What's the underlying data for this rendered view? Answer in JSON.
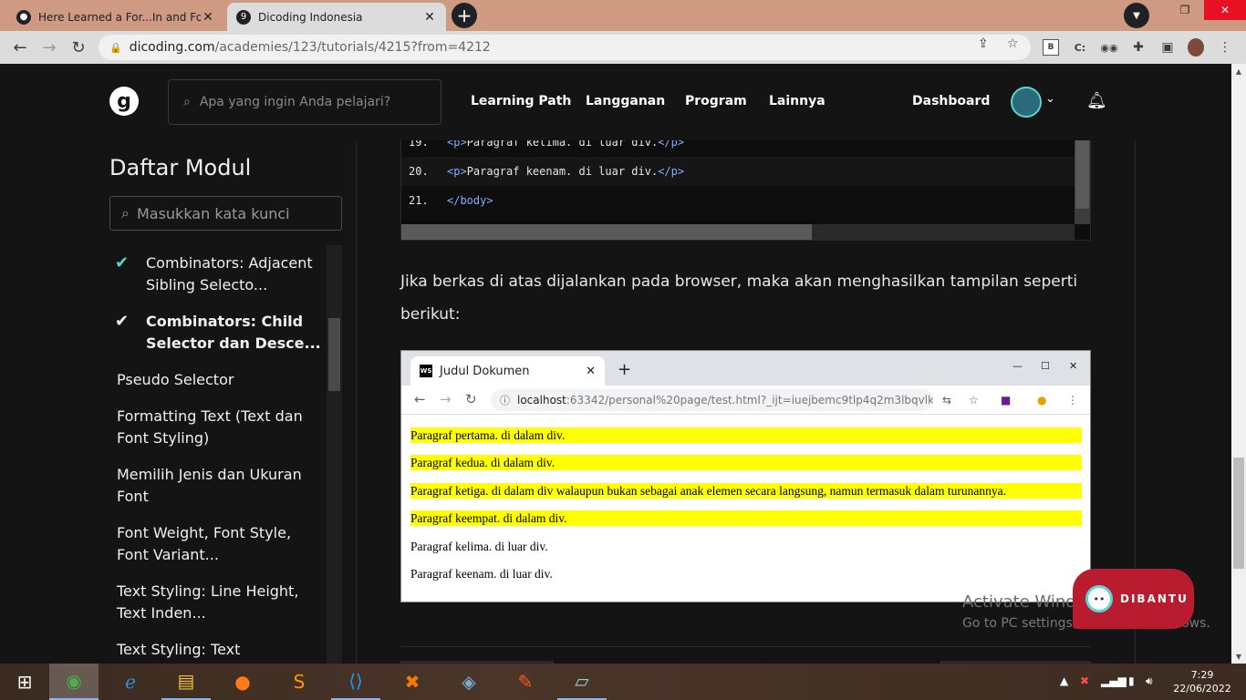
{
  "browser": {
    "tabs": [
      {
        "title": "Here Learned a For...In and For...O",
        "active": false
      },
      {
        "title": "Dicoding Indonesia",
        "active": true
      }
    ],
    "new_tab": "+",
    "url_host": "dicoding.com",
    "url_path": "/academies/123/tutorials/4215?from=4212"
  },
  "site": {
    "logo": "g",
    "search_placeholder": "Apa yang ingin Anda pelajari?",
    "nav": [
      "Learning Path",
      "Langganan",
      "Program",
      "Lainnya"
    ],
    "dashboard": "Dashboard"
  },
  "sidebar": {
    "title": "Daftar Modul",
    "search_placeholder": "Masukkan kata kunci",
    "items": [
      {
        "label": "Combinators: Adjacent Sibling Selecto...",
        "status": "done",
        "bold": false
      },
      {
        "label": "Combinators: Child Selector dan Desce...",
        "status": "current",
        "bold": true
      },
      {
        "label": "Pseudo Selector",
        "status": "none",
        "bold": false
      },
      {
        "label": "Formatting Text (Text dan Font Styling)",
        "status": "none",
        "bold": false
      },
      {
        "label": "Memilih Jenis dan Ukuran Font",
        "status": "none",
        "bold": false
      },
      {
        "label": "Font Weight, Font Style, Font Variant...",
        "status": "none",
        "bold": false
      },
      {
        "label": "Text Styling: Line Height, Text Inden...",
        "status": "none",
        "bold": false
      },
      {
        "label": "Text Styling: Text Decoration,",
        "status": "none",
        "bold": false
      }
    ]
  },
  "code": {
    "lines": [
      {
        "num": "19.",
        "open": "<p>",
        "text": "Paragraf kelima. di luar div.",
        "close": "</p>"
      },
      {
        "num": "20.",
        "open": "<p>",
        "text": "Paragraf keenam. di luar div.",
        "close": "</p>"
      },
      {
        "num": "21.",
        "open": "</body>",
        "text": "",
        "close": ""
      }
    ]
  },
  "content": {
    "paragraph": "Jika berkas di atas dijalankan pada browser, maka akan menghasilkan tampilan seperti berikut:"
  },
  "screenshot": {
    "tab_title": "Judul Dokumen",
    "url_host": "localhost",
    "url_rest": ":63342/personal%20page/test.html?_ijt=iuejbemc9tlp4q2m3lbqvlk...",
    "paragraphs": [
      {
        "text": "Paragraf pertama. di dalam div.",
        "highlight": true
      },
      {
        "text": "Paragraf kedua. di dalam div.",
        "highlight": true
      },
      {
        "text": "Paragraf ketiga. di dalam div walaupun bukan sebagai anak elemen secara langsung, namun termasuk dalam turunannya.",
        "highlight": true
      },
      {
        "text": "Paragraf keempat. di dalam div.",
        "highlight": true
      },
      {
        "text": "Paragraf kelima. di luar div.",
        "highlight": false
      },
      {
        "text": "Paragraf keenam. di luar div.",
        "highlight": false
      }
    ]
  },
  "overlay": {
    "activate_title": "Activate Windows",
    "activate_sub": "Go to PC settings to activate Windows.",
    "dibantu": "DIBANTU"
  },
  "taskbar": {
    "time": "7:29",
    "date": "22/06/2022"
  },
  "colors": {
    "highlight": "#ffff00",
    "check": "#5ad6d0",
    "dibantu": "#b81c2e"
  }
}
